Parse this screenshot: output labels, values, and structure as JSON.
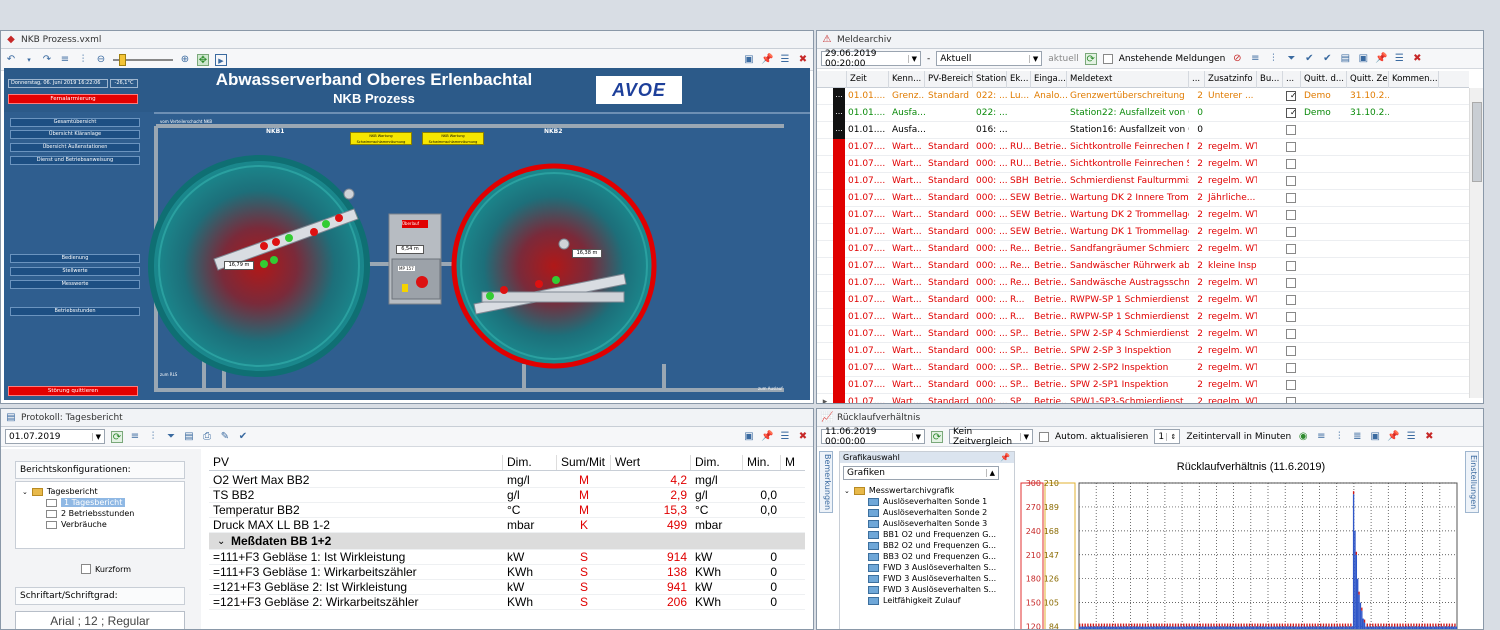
{
  "process_panel": {
    "title": "NKB Prozess.vxml",
    "header_title": "Abwasserverband Oberes Erlenbachtal",
    "header_subtitle": "NKB Prozess",
    "logo_text": "AVOE",
    "date_text": "Donnerstag, 06. Juni 2019 16:22:06",
    "temp_text": "-26,1°C",
    "alarm_button": "Fernalarmierung",
    "nav_top": [
      "Gesamtübersicht",
      "Übersicht Kläranlage",
      "Übersicht Außenstationen",
      "Dienst und Betriebsanweisung"
    ],
    "nav_bottom": [
      "Bedienung",
      "Stellwerte",
      "Messwerte"
    ],
    "nav_hours": "Betriebsstunden",
    "ack_button": "Störung quittieren",
    "label_nkb1": "NKB1",
    "label_nkb2": "NKB2",
    "label_verteiler": "vom Verteilerschacht NKB",
    "maint1": "NKB Wartung Schwimmschlammräumung",
    "maint2": "NKB Wartung Schwimmschlammräumung",
    "value_left": "16,79 m",
    "value_right": "16,38 m",
    "value_mid": "6,54 m",
    "overflow_label": "Überlauf",
    "mp_label": "MP 157",
    "rls_label": "zum RLS",
    "outlet_label": "zum Auslauf"
  },
  "meldearchiv": {
    "title": "Meldearchiv",
    "date": "29.06.2019 00:20:00",
    "mode": "Aktuell",
    "aktuell": "aktuell",
    "pending_label": "Anstehende Meldungen",
    "columns": [
      "Zeit",
      "Kenn...",
      "PV-Bereich",
      "Station",
      "Ek...",
      "Einga...",
      "Meldetext",
      "...",
      "Zusatzinfo",
      "Bu...",
      "...",
      "Quitt. d...",
      "Quitt. Zeit",
      "Kommen..."
    ],
    "rows": [
      {
        "zeit": "01.01....",
        "kenn": "Grenz...",
        "bereich": "Standard",
        "station": "022: ...",
        "ek": "Lu...",
        "eing": "Analo...",
        "text": "Grenzwertüberschreitung",
        "n": "2",
        "zusatz": "Unterer ...",
        "quitt": "Demo",
        "qzeit": "31.10.2...",
        "color": "#e07b00",
        "sq": "k",
        "checked": true
      },
      {
        "zeit": "01.01....",
        "kenn": "Ausfa...",
        "bereich": "",
        "station": "022: ...",
        "ek": "",
        "eing": "",
        "text": "Station22: Ausfallzeit von 0...",
        "n": "0",
        "zusatz": "",
        "quitt": "Demo",
        "qzeit": "31.10.2...",
        "color": "#0a8a0a",
        "sq": "k",
        "checked": true
      },
      {
        "zeit": "01.01....",
        "kenn": "Ausfa...",
        "bereich": "",
        "station": "016: ...",
        "ek": "",
        "eing": "",
        "text": "Station16: Ausfallzeit von 0...",
        "n": "0",
        "zusatz": "",
        "quitt": "",
        "qzeit": "",
        "color": "#000000",
        "sq": "k",
        "checked": false
      },
      {
        "zeit": "01.07....",
        "kenn": "Wart...",
        "bereich": "Standard",
        "station": "000: ...",
        "ek": "RU...",
        "eing": "Betrie...",
        "text": "Sichtkontrolle Feinrechen Nord",
        "n": "2",
        "zusatz": "regelm. WT",
        "quitt": "",
        "qzeit": "",
        "color": "#e00000",
        "sq": "r",
        "checked": false
      },
      {
        "zeit": "01.07....",
        "kenn": "Wart...",
        "bereich": "Standard",
        "station": "000: ...",
        "ek": "RU...",
        "eing": "Betrie...",
        "text": "Sichtkontrolle Feinrechen Süd",
        "n": "2",
        "zusatz": "regelm. WT",
        "quitt": "",
        "qzeit": "",
        "color": "#e00000",
        "sq": "r",
        "checked": false
      },
      {
        "zeit": "01.07....",
        "kenn": "Wart...",
        "bereich": "Standard",
        "station": "000: ...",
        "ek": "SBH",
        "eing": "Betrie...",
        "text": "Schmierdienst Faulturmmisc...",
        "n": "2",
        "zusatz": "regelm. WT",
        "quitt": "",
        "qzeit": "",
        "color": "#e00000",
        "sq": "r",
        "checked": false
      },
      {
        "zeit": "01.07....",
        "kenn": "Wart...",
        "bereich": "Standard",
        "station": "000: ...",
        "ek": "SEW",
        "eing": "Betrie...",
        "text": "Wartung DK 2 Innere Trom...",
        "n": "2",
        "zusatz": "Jährliche...",
        "quitt": "",
        "qzeit": "",
        "color": "#e00000",
        "sq": "r",
        "checked": false
      },
      {
        "zeit": "01.07....",
        "kenn": "Wart...",
        "bereich": "Standard",
        "station": "000: ...",
        "ek": "SEW",
        "eing": "Betrie...",
        "text": "Wartung DK 2 Trommellager...",
        "n": "2",
        "zusatz": "regelm. WT",
        "quitt": "",
        "qzeit": "",
        "color": "#e00000",
        "sq": "r",
        "checked": false
      },
      {
        "zeit": "01.07....",
        "kenn": "Wart...",
        "bereich": "Standard",
        "station": "000: ...",
        "ek": "SEW",
        "eing": "Betrie...",
        "text": "Wartung DK 1 Trommellager...",
        "n": "2",
        "zusatz": "regelm. WT",
        "quitt": "",
        "qzeit": "",
        "color": "#e00000",
        "sq": "r",
        "checked": false
      },
      {
        "zeit": "01.07....",
        "kenn": "Wart...",
        "bereich": "Standard",
        "station": "000: ...",
        "ek": "Re...",
        "eing": "Betrie...",
        "text": "Sandfangräumer Schmierdie...",
        "n": "2",
        "zusatz": "regelm. WT",
        "quitt": "",
        "qzeit": "",
        "color": "#e00000",
        "sq": "r",
        "checked": false
      },
      {
        "zeit": "01.07....",
        "kenn": "Wart...",
        "bereich": "Standard",
        "station": "000: ...",
        "ek": "Re...",
        "eing": "Betrie...",
        "text": "Sandwäscher Rührwerk abs...",
        "n": "2",
        "zusatz": "kleine Insp.",
        "quitt": "",
        "qzeit": "",
        "color": "#e00000",
        "sq": "r",
        "checked": false
      },
      {
        "zeit": "01.07....",
        "kenn": "Wart...",
        "bereich": "Standard",
        "station": "000: ...",
        "ek": "Re...",
        "eing": "Betrie...",
        "text": "Sandwäsche Austragsschne...",
        "n": "2",
        "zusatz": "regelm. WT",
        "quitt": "",
        "qzeit": "",
        "color": "#e00000",
        "sq": "r",
        "checked": false
      },
      {
        "zeit": "01.07....",
        "kenn": "Wart...",
        "bereich": "Standard",
        "station": "000: ...",
        "ek": "R...",
        "eing": "Betrie...",
        "text": "RWPW-SP 1 Schmierdienst",
        "n": "2",
        "zusatz": "regelm. WT",
        "quitt": "",
        "qzeit": "",
        "color": "#e00000",
        "sq": "r",
        "checked": false
      },
      {
        "zeit": "01.07....",
        "kenn": "Wart...",
        "bereich": "Standard",
        "station": "000: ...",
        "ek": "R...",
        "eing": "Betrie...",
        "text": "RWPW-SP 1 Schmierdienst",
        "n": "2",
        "zusatz": "regelm. WT",
        "quitt": "",
        "qzeit": "",
        "color": "#e00000",
        "sq": "r",
        "checked": false
      },
      {
        "zeit": "01.07....",
        "kenn": "Wart...",
        "bereich": "Standard",
        "station": "000: ...",
        "ek": "SP...",
        "eing": "Betrie...",
        "text": "SPW 2-SP 4 Schmierdienst",
        "n": "2",
        "zusatz": "regelm. WT",
        "quitt": "",
        "qzeit": "",
        "color": "#e00000",
        "sq": "r",
        "checked": false
      },
      {
        "zeit": "01.07....",
        "kenn": "Wart...",
        "bereich": "Standard",
        "station": "000: ...",
        "ek": "SP...",
        "eing": "Betrie...",
        "text": "SPW 2-SP 3 Inspektion",
        "n": "2",
        "zusatz": "regelm. WT",
        "quitt": "",
        "qzeit": "",
        "color": "#e00000",
        "sq": "r",
        "checked": false
      },
      {
        "zeit": "01.07....",
        "kenn": "Wart...",
        "bereich": "Standard",
        "station": "000: ...",
        "ek": "SP...",
        "eing": "Betrie...",
        "text": "SPW 2-SP2 Inspektion",
        "n": "2",
        "zusatz": "regelm. WT",
        "quitt": "",
        "qzeit": "",
        "color": "#e00000",
        "sq": "r",
        "checked": false
      },
      {
        "zeit": "01.07....",
        "kenn": "Wart...",
        "bereich": "Standard",
        "station": "000: ...",
        "ek": "SP...",
        "eing": "Betrie...",
        "text": "SPW 2-SP1 Inspektion",
        "n": "2",
        "zusatz": "regelm. WT",
        "quitt": "",
        "qzeit": "",
        "color": "#e00000",
        "sq": "r",
        "checked": false
      },
      {
        "zeit": "01.07....",
        "kenn": "Wart...",
        "bereich": "Standard",
        "station": "000: ...",
        "ek": "SP...",
        "eing": "Betrie...",
        "text": "SPW1-SP3-Schmierdienst",
        "n": "2",
        "zusatz": "regelm. WT",
        "quitt": "",
        "qzeit": "",
        "color": "#e00000",
        "sq": "r",
        "checked": false
      }
    ]
  },
  "protokoll": {
    "title": "Protokoll: Tagesbericht",
    "date": "01.07.2019",
    "config_label": "Berichtskonfigurationen:",
    "tree_root": "Tagesbericht",
    "tree_items": [
      "1 Tagesbericht",
      "2 Betriebsstunden",
      "Verbräuche"
    ],
    "kurzform": "Kurzform",
    "font_label": "Schriftart/Schriftgrad:",
    "font_value": "Arial ; 12 ; Regular",
    "columns": [
      "PV",
      "Dim.",
      "Sum/Mit",
      "Wert",
      "Dim.",
      "Min.",
      "M"
    ],
    "rows": [
      {
        "pv": "O2 Wert Max BB2",
        "dim": "mg/l",
        "sum": "M",
        "wert": "4,2",
        "dim2": "mg/l",
        "min": ""
      },
      {
        "pv": "TS BB2",
        "dim": "g/l",
        "sum": "M",
        "wert": "2,9",
        "dim2": "g/l",
        "min": "0,0"
      },
      {
        "pv": "Temperatur BB2",
        "dim": "°C",
        "sum": "M",
        "wert": "15,3",
        "dim2": "°C",
        "min": "0,0"
      },
      {
        "pv": "Druck MAX LL BB 1-2",
        "dim": "mbar",
        "sum": "K",
        "wert": "499",
        "dim2": "mbar",
        "min": ""
      }
    ],
    "group_label": "Meßdaten BB 1+2",
    "rows2": [
      {
        "pv": "=111+F3 Gebläse 1: Ist Wirkleistung",
        "dim": "kW",
        "sum": "S",
        "wert": "914",
        "dim2": "kW",
        "min": "0"
      },
      {
        "pv": "=111+F3 Gebläse 1: Wirkarbeitszähler",
        "dim": "KWh",
        "sum": "S",
        "wert": "138",
        "dim2": "KWh",
        "min": "0"
      },
      {
        "pv": "=121+F3 Gebläse 2: Ist Wirkleistung",
        "dim": "kW",
        "sum": "S",
        "wert": "941",
        "dim2": "kW",
        "min": "0"
      },
      {
        "pv": "=121+F3 Gebläse 2: Wirkarbeitszähler",
        "dim": "KWh",
        "sum": "S",
        "wert": "206",
        "dim2": "KWh",
        "min": "0"
      }
    ]
  },
  "ruecklauf": {
    "title": "Rücklaufverhältnis",
    "date": "11.06.2019 00:00:00",
    "compare": "Kein Zeitvergleich",
    "auto": "Autom. aktualisieren",
    "interval_value": "1",
    "interval_label": "Zeitintervall in Minuten",
    "side_left": "Bemerkungen",
    "side_right": "Einstellungen",
    "tree_title": "Grafikauswahl",
    "tree_combo": "Grafiken",
    "tree_root": "Messwertarchivgrafik",
    "tree_items": [
      "Auslöseverhalten Sonde 1",
      "Auslöseverhalten Sonde 2",
      "Auslöseverhalten Sonde 3",
      "BB1 O2 und Frequenzen G...",
      "BB2 O2 und Frequenzen G...",
      "BB3 O2 und Frequenzen G...",
      "FWD 3 Auslöseverhalten S...",
      "FWD 3 Auslöseverhalten S...",
      "FWD 3 Auslöseverhalten S...",
      "Leitfähigkeit Zulauf"
    ]
  },
  "chart_data": {
    "type": "bar",
    "title": "Rücklaufverhältnis (11.6.2019)",
    "y1_ticks": [
      300,
      270,
      240,
      210,
      180,
      150,
      120
    ],
    "y2_ticks": [
      210,
      189,
      168,
      147,
      126,
      105,
      84
    ],
    "y1lim": [
      120,
      300
    ],
    "grid": true,
    "series_colors": [
      "#2f56c8",
      "#d11a1a"
    ],
    "values": [
      92,
      95,
      88,
      100,
      97,
      91,
      105,
      99,
      94,
      96,
      110,
      93,
      98,
      102,
      95,
      90,
      97,
      104,
      99,
      96,
      93,
      101,
      108,
      97,
      94,
      99,
      95,
      102,
      98,
      93,
      106,
      100,
      95,
      97,
      92,
      103,
      99,
      96,
      110,
      98,
      94,
      97,
      101,
      95,
      99,
      104,
      96,
      93,
      98,
      102,
      97,
      95,
      100,
      106,
      94,
      98,
      96,
      101,
      97,
      93,
      99,
      105,
      96,
      94,
      102,
      98,
      95,
      99,
      104,
      97,
      93,
      100,
      96,
      98,
      103,
      95,
      99,
      97,
      101,
      94,
      98,
      96,
      100,
      105,
      97,
      94,
      99,
      103,
      96,
      98,
      95,
      101,
      97,
      120,
      99,
      96,
      103,
      98,
      95,
      100,
      97,
      94,
      102,
      98,
      96,
      99,
      104,
      95,
      97,
      101,
      98,
      94,
      100,
      96,
      103,
      99,
      97,
      95,
      101,
      98,
      94,
      100,
      97,
      103,
      96,
      99,
      95,
      98,
      102,
      97,
      94,
      100,
      96,
      99,
      105,
      98,
      95,
      101,
      97,
      94,
      99,
      103,
      96,
      98,
      100,
      95,
      97,
      102,
      99,
      94,
      98,
      96,
      101,
      97,
      95,
      100,
      104,
      98,
      96,
      99,
      97,
      94,
      101,
      98,
      95,
      100,
      97,
      103,
      99,
      96,
      98,
      95,
      101,
      97,
      94,
      100,
      98,
      96,
      99,
      102,
      95,
      97,
      100,
      98,
      94,
      101,
      96,
      99,
      97,
      95,
      100,
      98,
      103,
      96,
      99,
      97,
      94,
      101,
      98,
      95,
      286,
      240,
      210,
      180,
      160,
      150,
      140,
      130,
      125,
      118,
      112,
      108,
      104,
      101,
      99,
      97,
      96,
      98,
      100,
      97,
      95,
      99,
      101,
      98,
      96,
      100,
      97,
      99,
      102,
      98,
      95,
      97,
      100,
      98,
      96,
      99,
      101,
      97,
      95,
      98,
      100,
      96,
      99,
      97,
      103,
      98,
      95,
      100,
      97,
      99,
      96,
      98,
      101,
      97,
      95,
      99,
      100,
      98,
      96,
      97,
      102,
      99,
      95,
      98,
      100,
      97,
      96,
      99,
      101,
      98,
      95,
      97,
      100,
      99,
      96,
      98
    ]
  }
}
